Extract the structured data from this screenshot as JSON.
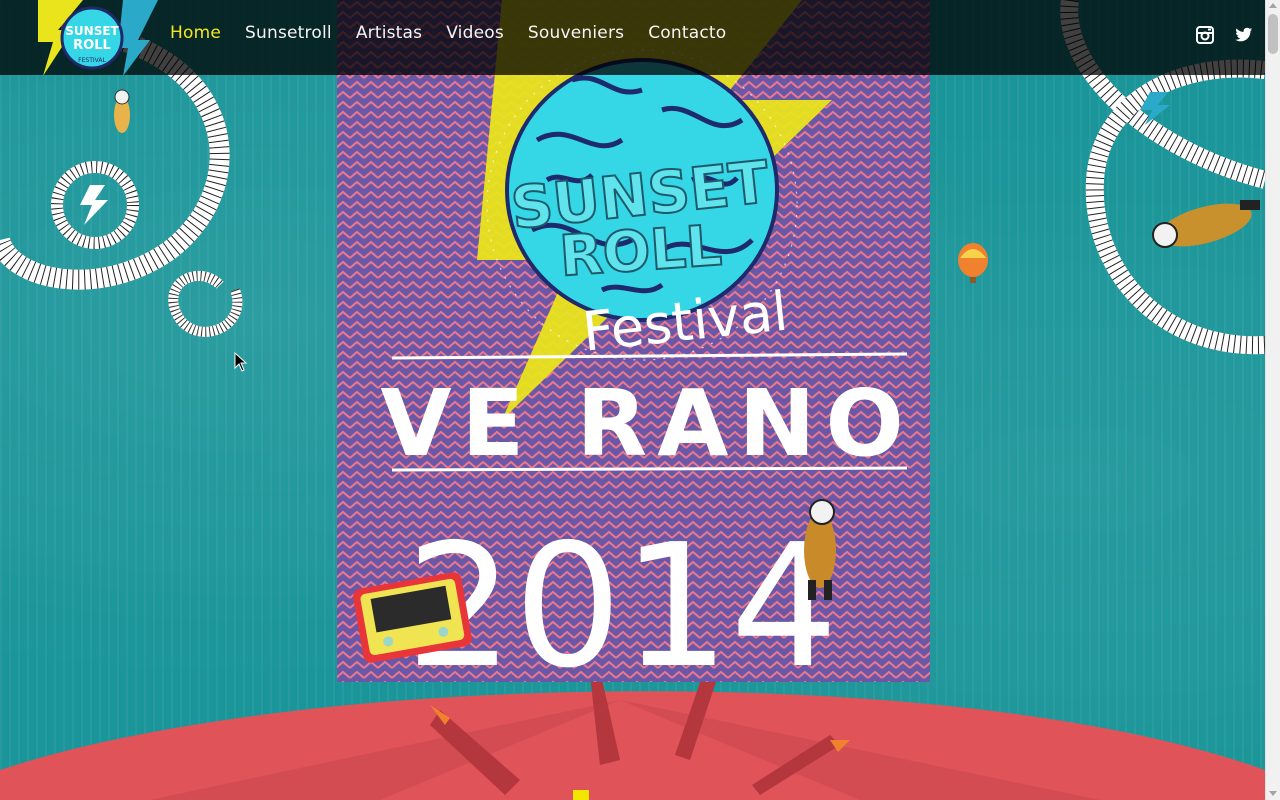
{
  "brand": {
    "logo_text_line1": "SUNSET",
    "logo_text_line2": "ROLL",
    "logo_text_line3": "FESTIVAL"
  },
  "nav": {
    "items": [
      {
        "label": "Home",
        "active": true
      },
      {
        "label": "Sunsetroll",
        "active": false
      },
      {
        "label": "Artistas",
        "active": false
      },
      {
        "label": "Videos",
        "active": false
      },
      {
        "label": "Souveniers",
        "active": false
      },
      {
        "label": "Contacto",
        "active": false
      }
    ]
  },
  "social": {
    "instagram_icon": "instagram-icon",
    "twitter_icon": "twitter-icon"
  },
  "poster": {
    "title_line1": "SUNSET",
    "title_line2": "ROLL",
    "subtitle": "Festival",
    "season": "VE RANO",
    "year": "2014"
  },
  "colors": {
    "nav_active": "#f7e81e",
    "nav_text": "#f4f4f4",
    "teal": "#1a9599",
    "poster_purple": "#6a57a6",
    "stage_red": "#e0535a",
    "brain_cyan": "#35d6e6",
    "bolt_yellow": "#f2e600"
  }
}
